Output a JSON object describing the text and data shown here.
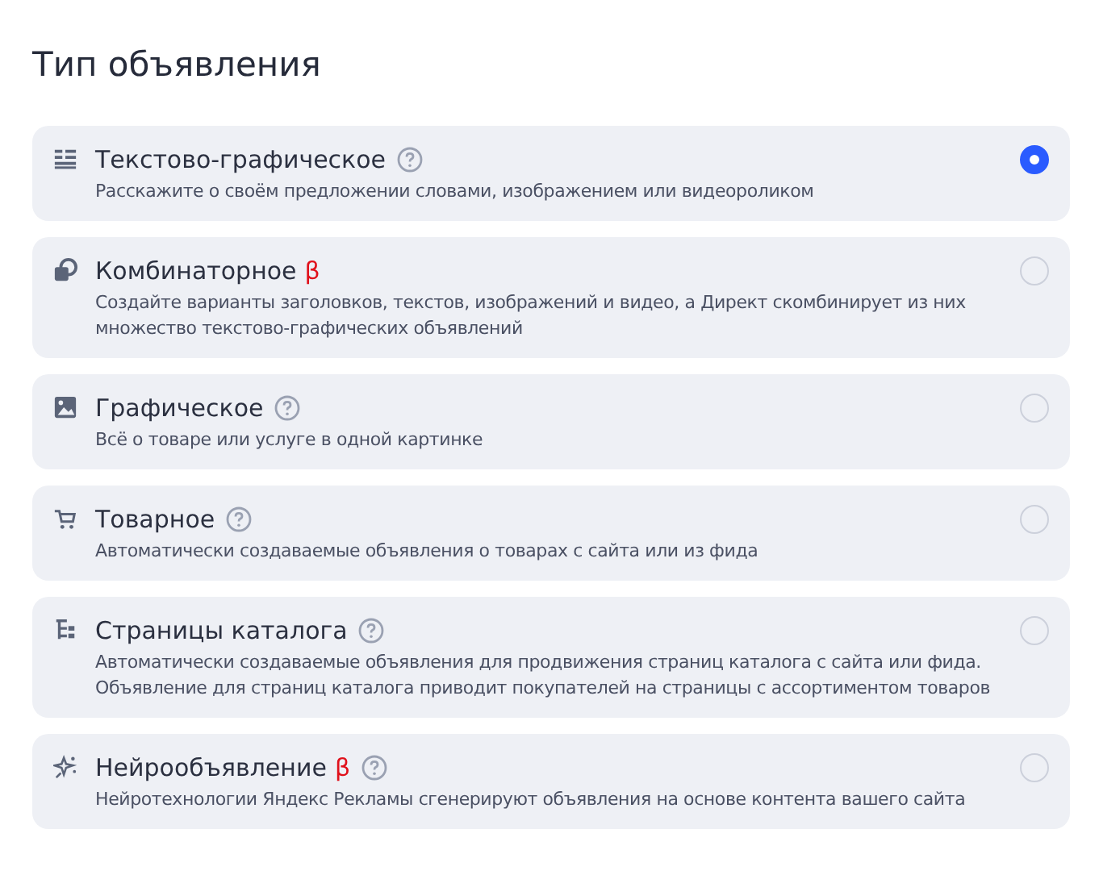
{
  "heading": "Тип объявления",
  "options": [
    {
      "title": "Текстово-графическое",
      "help": true,
      "description": [
        "Расскажите о своём предложении словами, изображением или видеороликом"
      ],
      "selected": true
    },
    {
      "title": "Комбинаторное",
      "beta": "β",
      "help": false,
      "description": [
        "Создайте варианты заголовков, текстов, изображений и видео, а Директ скомбинирует из них",
        "множество текстово-графических объявлений"
      ],
      "selected": false
    },
    {
      "title": "Графическое",
      "help": true,
      "description": [
        "Всё о товаре или услуге в одной картинке"
      ],
      "selected": false
    },
    {
      "title": "Товарное",
      "help": true,
      "description": [
        "Автоматически создаваемые объявления о товарах с сайта или из фида"
      ],
      "selected": false
    },
    {
      "title": "Страницы каталога",
      "help": true,
      "description": [
        "Автоматически создаваемые объявления для продвижения страниц каталога с сайта или фида.",
        "Объявление для страниц каталога приводит покупателей на страницы с ассортиментом товаров"
      ],
      "selected": false
    },
    {
      "title": "Нейрообъявление",
      "beta": "β",
      "help": true,
      "description": [
        "Нейротехнологии Яндекс Рекламы сгенерируют объявления на основе контента вашего сайта"
      ],
      "selected": false
    }
  ]
}
